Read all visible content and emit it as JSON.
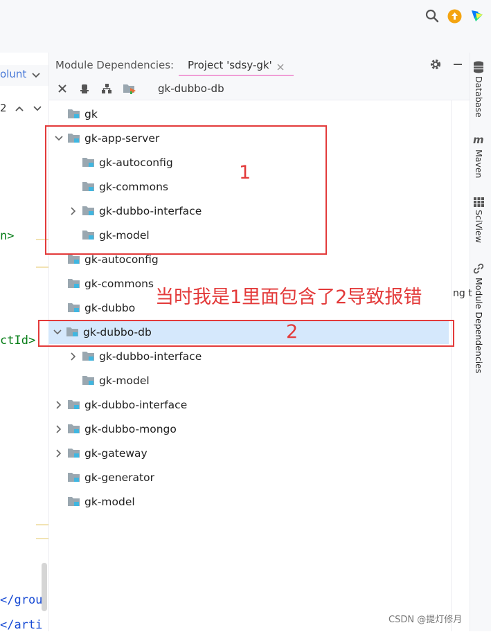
{
  "top_icons": [
    "search-icon",
    "update-icon",
    "jetbrains-logo-icon"
  ],
  "editor": {
    "header_fragment": "olunt",
    "nav_counter": "2",
    "code_lines": [
      {
        "text": "n>"
      },
      {
        "text": "ctId>"
      },
      {
        "text": "</grou"
      },
      {
        "text": "</arti"
      }
    ]
  },
  "tool_window": {
    "title": "Module Dependencies:",
    "tab_label": "Project 'sdsy-gk'",
    "selected_module": "gk-dubbo-db",
    "toolbar_icons": [
      "close-icon",
      "pin-icon",
      "hierarchy-icon",
      "module-settings-icon"
    ]
  },
  "tree": [
    {
      "label": "gk",
      "indent": 0,
      "chevron": "none",
      "selected": false
    },
    {
      "label": "gk-app-server",
      "indent": 0,
      "chevron": "down",
      "selected": false
    },
    {
      "label": "gk-autoconfig",
      "indent": 1,
      "chevron": "none",
      "selected": false
    },
    {
      "label": "gk-commons",
      "indent": 1,
      "chevron": "none",
      "selected": false
    },
    {
      "label": "gk-dubbo-interface",
      "indent": 1,
      "chevron": "right",
      "selected": false
    },
    {
      "label": "gk-model",
      "indent": 1,
      "chevron": "none",
      "selected": false
    },
    {
      "label": "gk-autoconfig",
      "indent": 0,
      "chevron": "none",
      "selected": false
    },
    {
      "label": "gk-commons",
      "indent": 0,
      "chevron": "none",
      "selected": false
    },
    {
      "label": "gk-dubbo",
      "indent": 0,
      "chevron": "none",
      "selected": false
    },
    {
      "label": "gk-dubbo-db",
      "indent": 0,
      "chevron": "down",
      "selected": true
    },
    {
      "label": "gk-dubbo-interface",
      "indent": 1,
      "chevron": "right",
      "selected": false
    },
    {
      "label": "gk-model",
      "indent": 1,
      "chevron": "none",
      "selected": false
    },
    {
      "label": "gk-dubbo-interface",
      "indent": 0,
      "chevron": "right",
      "selected": false
    },
    {
      "label": "gk-dubbo-mongo",
      "indent": 0,
      "chevron": "right",
      "selected": false
    },
    {
      "label": "gk-gateway",
      "indent": 0,
      "chevron": "right",
      "selected": false
    },
    {
      "label": "gk-generator",
      "indent": 0,
      "chevron": "none",
      "selected": false
    },
    {
      "label": "gk-model",
      "indent": 0,
      "chevron": "none",
      "selected": false
    }
  ],
  "right_stripe": {
    "database": "Database",
    "maven": "Maven",
    "sciview": "SciView",
    "module_dependencies": "Module Dependencies",
    "truncated_text": "ng t"
  },
  "annotations": {
    "box1_label": "1",
    "box2_label": "2",
    "note": "当时我是1里面包含了2导致报错"
  },
  "watermark": "CSDN @提灯修月",
  "colors": {
    "annotation": "#e33a3a",
    "selection": "#d5e8fc",
    "tab_underline": "#f09ed6",
    "folder": "#9aa7b0",
    "module_badge": "#40b6e0"
  }
}
